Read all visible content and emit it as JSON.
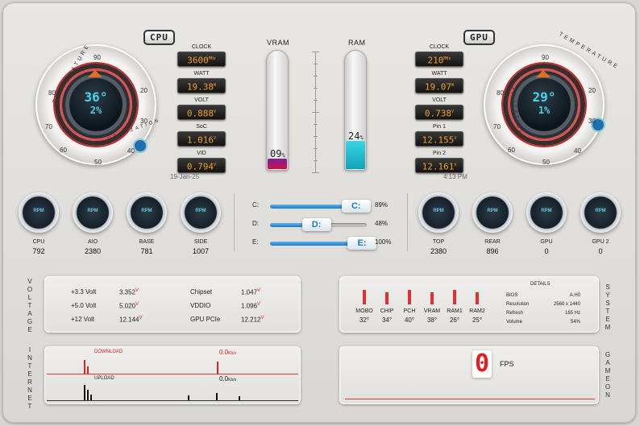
{
  "cpu": {
    "badge": "CPU",
    "temp": "36°",
    "util": "2%",
    "arc_top": "TEMPERATURE",
    "arc_bottom": "UTILIZATION",
    "ticks": [
      "90",
      "80",
      "70",
      "60",
      "50",
      "40",
      "30",
      "20"
    ],
    "readouts": [
      {
        "label": "CLOCK",
        "value": "3600",
        "unit": "MHz"
      },
      {
        "label": "WATT",
        "value": "19.38",
        "unit": "W"
      },
      {
        "label": "VOLT",
        "value": "0.888",
        "unit": "V"
      },
      {
        "label": "SoC",
        "value": "1.016",
        "unit": "V"
      },
      {
        "label": "VID",
        "value": "0.794",
        "unit": "V"
      }
    ],
    "date": "19-Jan-25"
  },
  "gpu": {
    "badge": "GPU",
    "temp": "29°",
    "util": "1%",
    "arc_top": "TEMPERATURE",
    "arc_bottom": "UTILIZATION",
    "ticks": [
      "90",
      "80",
      "70",
      "60",
      "50",
      "40",
      "30",
      "20"
    ],
    "readouts": [
      {
        "label": "CLOCK",
        "value": "210",
        "unit": "MHz"
      },
      {
        "label": "WATT",
        "value": "19.07",
        "unit": "W"
      },
      {
        "label": "VOLT",
        "value": "0.738",
        "unit": "V"
      },
      {
        "label": "Pin 1",
        "value": "12.155",
        "unit": "V"
      },
      {
        "label": "Pin 2",
        "value": "12.161",
        "unit": "V"
      }
    ],
    "time": "4:13 PM"
  },
  "memory": {
    "vram_label": "VRAM",
    "vram_value": "09",
    "vram_fraction": 0.09,
    "ram_label": "RAM",
    "ram_value": "24",
    "ram_fraction": 0.24,
    "pct_sign": "%"
  },
  "fans_left": [
    {
      "name": "CPU",
      "rpm": "792"
    },
    {
      "name": "AIO",
      "rpm": "2380"
    },
    {
      "name": "BASE",
      "rpm": "781"
    },
    {
      "name": "SIDE",
      "rpm": "1007"
    }
  ],
  "fans_right": [
    {
      "name": "TOP",
      "rpm": "2380"
    },
    {
      "name": "REAR",
      "rpm": "896"
    },
    {
      "name": "GPU",
      "rpm": "0"
    },
    {
      "name": "GPU 2",
      "rpm": "0"
    }
  ],
  "fan_icon_text": "RPM",
  "drives": [
    {
      "label": "C:",
      "letter": "C:",
      "percent": "89%",
      "fraction": 0.89
    },
    {
      "label": "D:",
      "letter": "D:",
      "percent": "48%",
      "fraction": 0.48
    },
    {
      "label": "E:",
      "letter": "E:",
      "percent": "100%",
      "fraction": 1.0
    }
  ],
  "voltage": {
    "title": "VOLTAGE",
    "rows": [
      {
        "label": "+3.3 Volt",
        "value": "3.352",
        "unit": "V"
      },
      {
        "label": "+5.0 Volt",
        "value": "5.020",
        "unit": "V"
      },
      {
        "label": "+12  Volt",
        "value": "12.144",
        "unit": "V"
      }
    ],
    "rows2": [
      {
        "label": "Chipset",
        "value": "1.047",
        "unit": "V"
      },
      {
        "label": "VDDIO",
        "value": "1.096",
        "unit": "V"
      },
      {
        "label": "GPU PCIe",
        "value": "12.212",
        "unit": "V"
      }
    ]
  },
  "system": {
    "title": "SYSTEM",
    "temps": [
      {
        "label": "MOBO",
        "value": "32°"
      },
      {
        "label": "CHIP",
        "value": "34°"
      },
      {
        "label": "PCH",
        "value": "40°"
      },
      {
        "label": "VRAM",
        "value": "38°"
      },
      {
        "label": "RAM1",
        "value": "26°"
      },
      {
        "label": "RAM2",
        "value": "25°"
      }
    ],
    "details_title": "DETAILS",
    "details": [
      {
        "label": "BIOS",
        "value": "A.H0"
      },
      {
        "label": "Resolution",
        "value": "2560 x 1440"
      },
      {
        "label": "Refresh",
        "value": "165 Hz"
      },
      {
        "label": "Volume",
        "value": "54%"
      }
    ]
  },
  "internet": {
    "title": "INTERNET",
    "download_label": "DOWNLOAD",
    "download_value": "0.0",
    "download_unit": "Kb/s",
    "upload_label": "UPLOAD",
    "upload_value": "0.0",
    "upload_unit": "Kb/s"
  },
  "game": {
    "title": "GAME ON",
    "fps_value": "0",
    "fps_label": "FPS"
  },
  "colors": {
    "accent_blue": "#45d4ea",
    "readout_amber": "#f0a020",
    "vram_fill": "#b0185a",
    "ram_fill": "#2ac3d6",
    "alert_red": "#e02020"
  }
}
